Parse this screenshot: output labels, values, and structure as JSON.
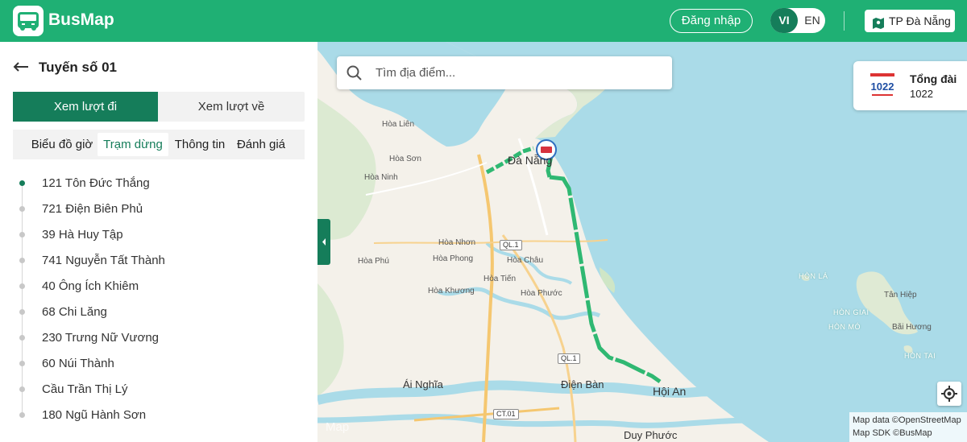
{
  "header": {
    "app_name": "BusMap",
    "login_label": "Đăng nhập",
    "lang_vi": "VI",
    "lang_en": "EN",
    "city_label": "TP Đà Nẵng"
  },
  "panel": {
    "route_title": "Tuyến số 01",
    "direction_tabs": {
      "outbound": "Xem lượt đi",
      "return": "Xem lượt về"
    },
    "sub_tabs": [
      "Biểu đồ giờ",
      "Trạm dừng",
      "Thông tin",
      "Đánh giá"
    ],
    "active_sub_tab": "Trạm dừng",
    "stops": [
      "121 Tôn Đức Thắng",
      "721 Điện Biên Phủ",
      "39 Hà Huy Tập",
      "741 Nguyễn Tất Thành",
      "40 Ông Ích Khiêm",
      "68 Chi Lăng",
      "230 Trưng Nữ Vương",
      "60 Núi Thành",
      "Cầu Trần Thị Lý",
      "180 Ngũ Hành Sơn"
    ]
  },
  "map": {
    "search_placeholder": "Tìm địa điểm...",
    "hotline": {
      "title": "Tổng đài",
      "number": "1022",
      "logo_text": "1022"
    },
    "labels": {
      "hoa_lien": "Hòa Liên",
      "hoa_son": "Hòa Sơn",
      "hoa_ninh": "Hòa Ninh",
      "da_nang": "Đà Nẵng",
      "hoa_nhon": "Hòa Nhơn",
      "hoa_phu": "Hòa Phú",
      "hoa_phong": "Hòa Phong",
      "hoa_chau": "Hòa Châu",
      "hoa_tien": "Hòa Tiến",
      "hoa_khuong": "Hòa Khương",
      "hoa_phuoc": "Hòa Phước",
      "ai_nghia": "Ái Nghĩa",
      "dien_ban": "Điện Bàn",
      "hoi_an": "Hội An",
      "duy_phuoc": "Duy Phước",
      "hon_la": "HÒN LÁ",
      "tan_hiep": "Tân Hiệp",
      "hon_giai": "HÒN GIAI",
      "hon_mo": "HÒN MÓ",
      "bai_huong": "Bãi Hương",
      "hon_tai": "HÒN TAI",
      "ql1_a": "QL.1",
      "ql1_b": "QL.1",
      "ct01": "CT.01",
      "watermark": "Map"
    },
    "attribution": [
      "Map data ©OpenStreetMap",
      "Map SDK ©BusMap"
    ]
  },
  "colors": {
    "brand": "#1fb074",
    "brand_dark": "#157d5a",
    "route": "#2fb872",
    "sea": "#aadbe8",
    "land": "#f4f1ea"
  }
}
